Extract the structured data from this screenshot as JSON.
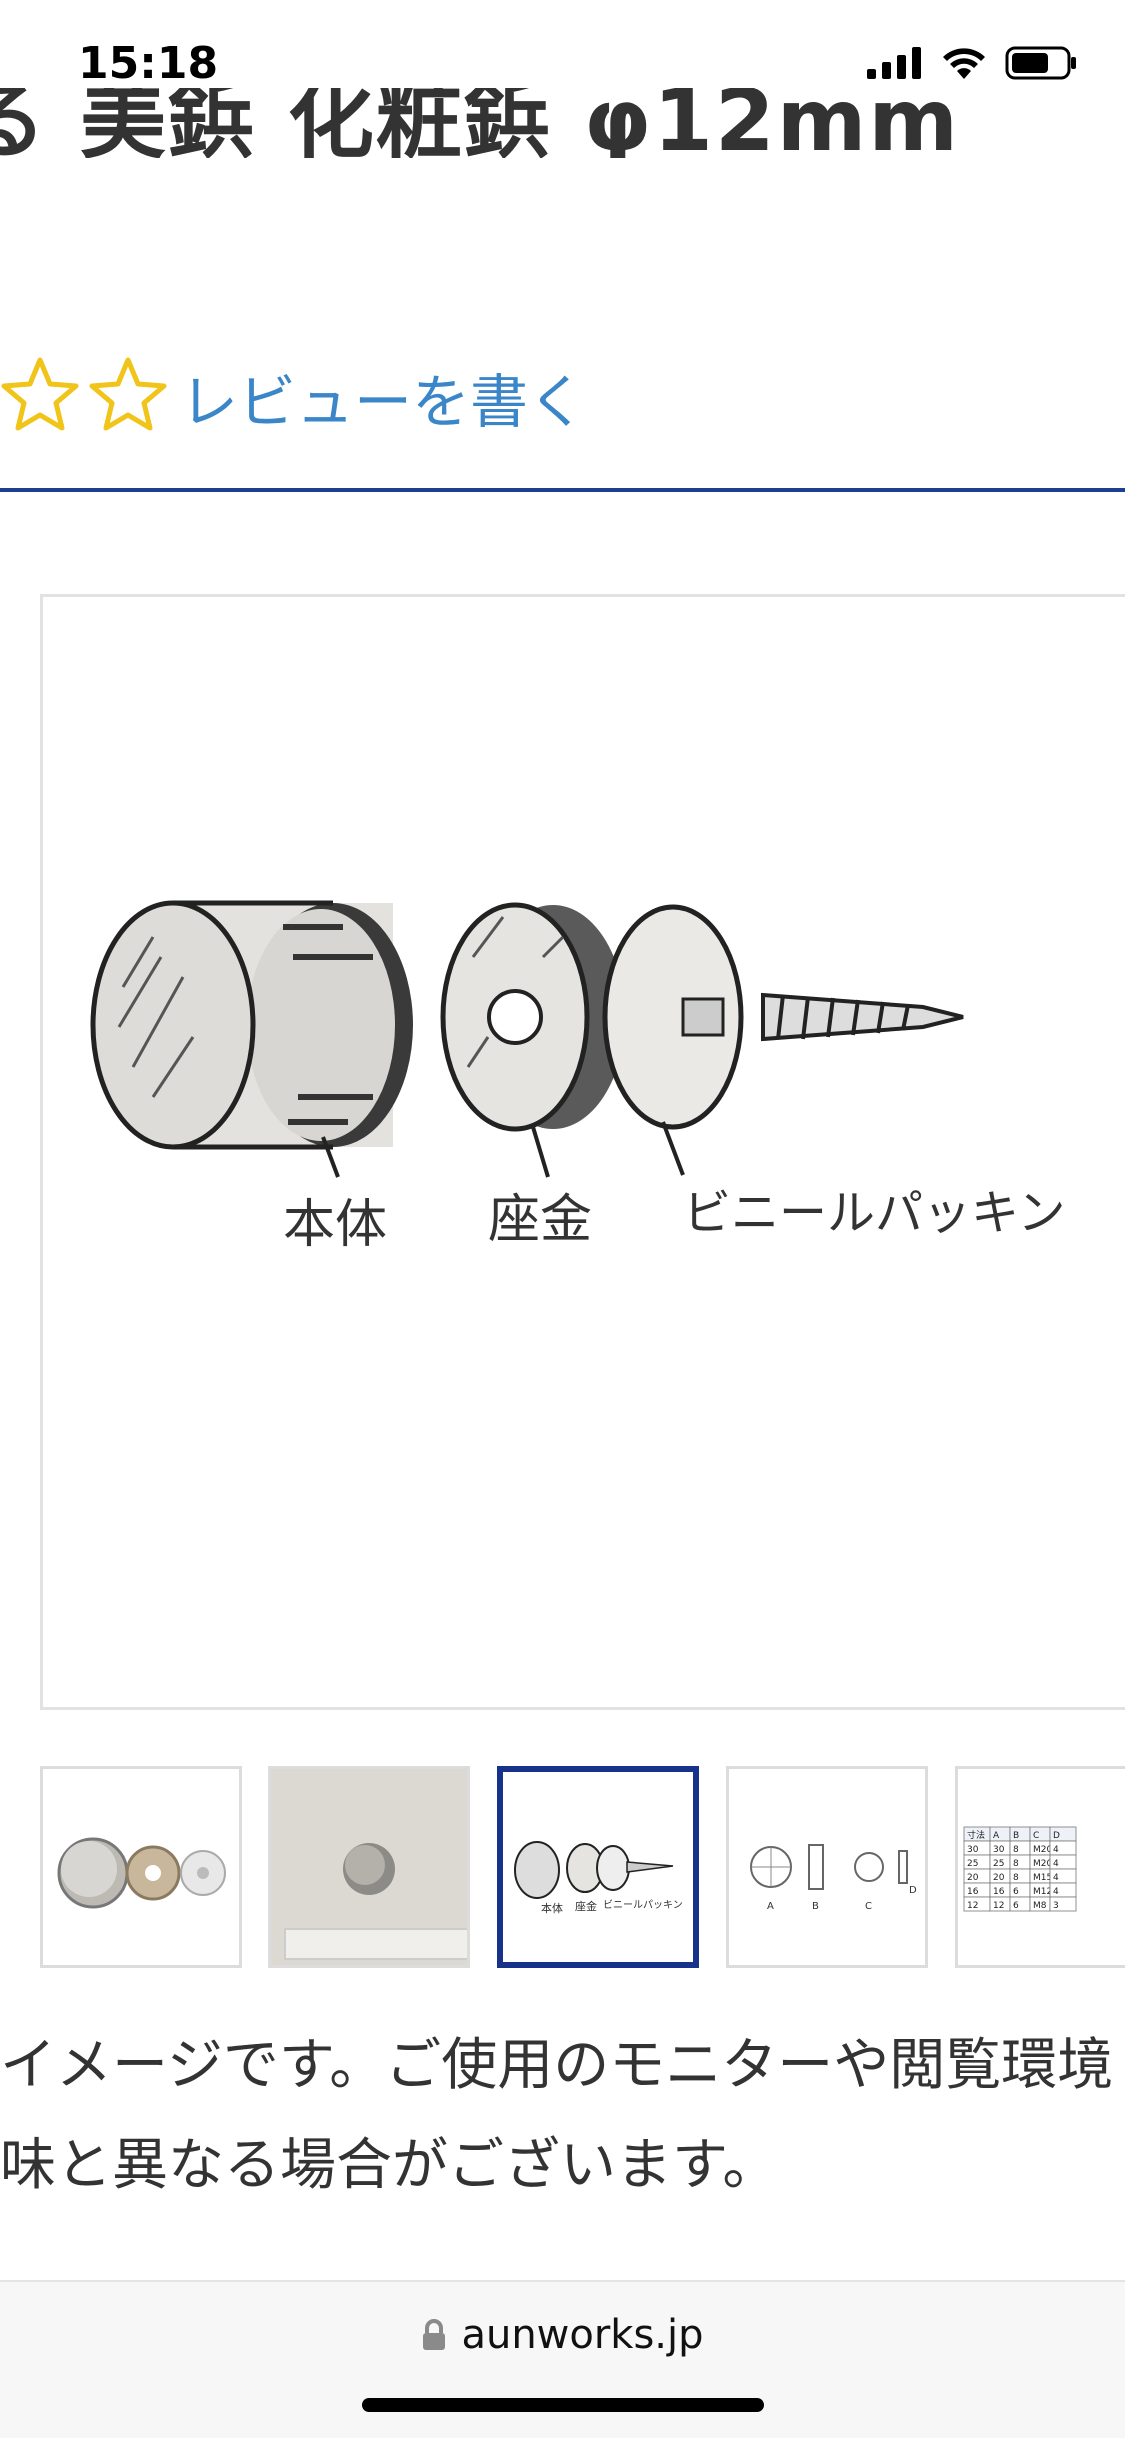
{
  "status_bar": {
    "time": "15:18"
  },
  "product": {
    "title_partial": "る 美鋲 化粧鋲 φ12mm"
  },
  "review": {
    "link_text": "レビューを書く",
    "star_count": 2
  },
  "gallery": {
    "labels": {
      "body": "本体",
      "washer": "座金",
      "packing": "ビニールパッキン"
    },
    "thumb_labels": {
      "body": "本体",
      "washer": "座金",
      "packing": "ビニールパッキン",
      "a": "A",
      "b": "B",
      "c": "C",
      "d": "D"
    },
    "spec_table": {
      "headers": [
        "寸法",
        "A",
        "B",
        "C",
        "D"
      ],
      "rows": [
        [
          "30",
          "30",
          "8",
          "M20",
          "4"
        ],
        [
          "25",
          "25",
          "8",
          "M20",
          "4"
        ],
        [
          "20",
          "20",
          "8",
          "M15",
          "4"
        ],
        [
          "16",
          "16",
          "6",
          "M12",
          "4"
        ],
        [
          "12",
          "12",
          "6",
          "M8",
          "3"
        ]
      ]
    },
    "selected_index": 2
  },
  "caption": {
    "line1": "イメージです。ご使用のモニターや閲覧環境",
    "line2": "味と異なる場合がございます。"
  },
  "browser": {
    "url": "aunworks.jp"
  }
}
